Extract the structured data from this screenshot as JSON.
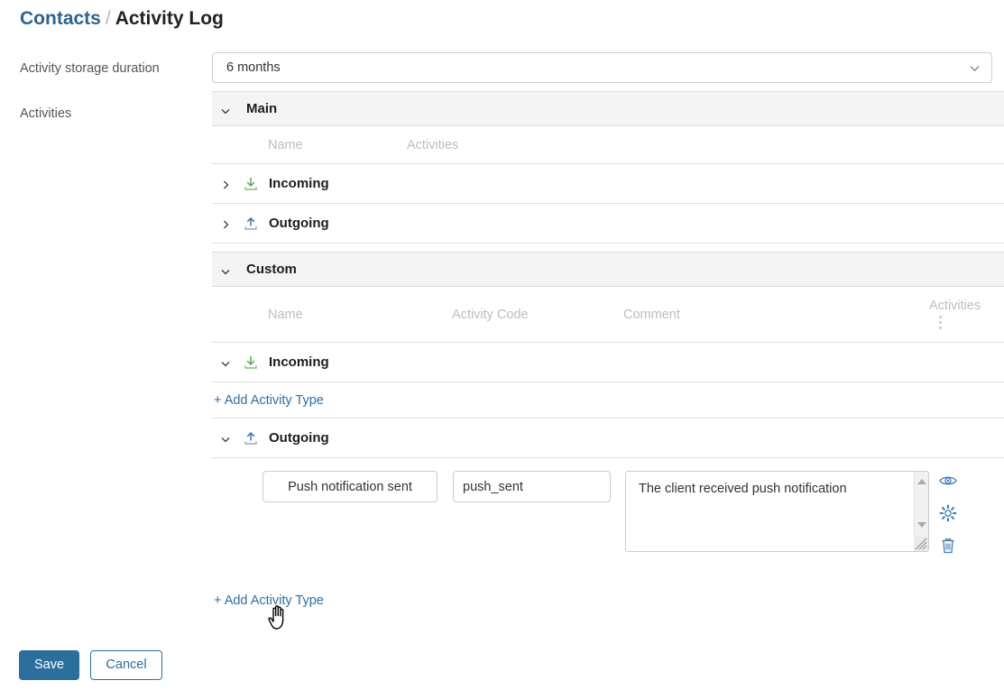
{
  "breadcrumb": {
    "parent": "Contacts",
    "separator": "/",
    "current": "Activity Log"
  },
  "labels": {
    "storage_duration": "Activity storage duration",
    "activities": "Activities"
  },
  "storage_duration_select": {
    "value": "6 months",
    "icon": "chevron-down-icon"
  },
  "groups": [
    {
      "title": "Main",
      "expanded": true,
      "caret_icon": "chevron-down-icon",
      "columns": {
        "name": "Name",
        "activities": "Activities"
      },
      "rows": [
        {
          "name": "Incoming",
          "icon": "download-icon",
          "expanded": false,
          "caret_icon": "chevron-right-icon"
        },
        {
          "name": "Outgoing",
          "icon": "upload-icon",
          "expanded": false,
          "caret_icon": "chevron-right-icon"
        }
      ]
    },
    {
      "title": "Custom",
      "expanded": true,
      "caret_icon": "chevron-down-icon",
      "columns": {
        "name": "Name",
        "activity_code": "Activity Code",
        "comment": "Comment",
        "activities": "Activities",
        "menu_icon": "kebab-menu-icon"
      },
      "rows": [
        {
          "name": "Incoming",
          "icon": "download-icon",
          "expanded": true,
          "caret_icon": "chevron-down-icon"
        },
        {
          "name": "Outgoing",
          "icon": "upload-icon",
          "expanded": true,
          "caret_icon": "chevron-down-icon"
        }
      ]
    }
  ],
  "add_links": {
    "incoming": "+ Add Activity Type",
    "outgoing": "+ Add Activity Type"
  },
  "activity_entry": {
    "name": "Push notification sent",
    "activity_code": "push_sent",
    "comment": "The client received push notification",
    "actions": [
      {
        "icon": "eye-icon",
        "name": "view"
      },
      {
        "icon": "gear-icon",
        "name": "settings"
      },
      {
        "icon": "trash-icon",
        "name": "delete"
      }
    ]
  },
  "footer": {
    "save": "Save",
    "cancel": "Cancel"
  },
  "colors": {
    "link": "#2a6496",
    "accent": "#2a6f9e",
    "download_icon": "#5aab4f",
    "upload_icon": "#3d6fb0",
    "header_bg": "#f4f4f4",
    "border": "#dddddd",
    "muted_text": "#bdbdbd"
  },
  "cursor": {
    "icon": "pointer-hand-cursor"
  }
}
